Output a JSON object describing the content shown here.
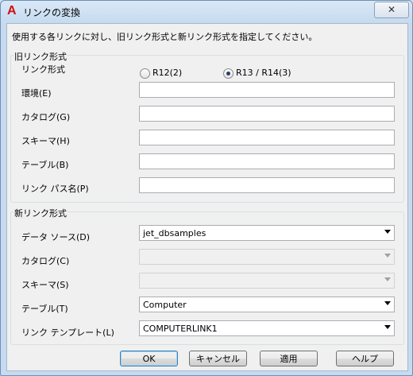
{
  "window": {
    "title": "リンクの変換",
    "close_label": "✕"
  },
  "instruction": "使用する各リンクに対し、旧リンク形式と新リンク形式を指定してください。",
  "old_link": {
    "group_title": "旧リンク形式",
    "format_label": "リンク形式",
    "radio_r12": "R12(2)",
    "radio_r13": "R13 / R14(3)",
    "selected": "R13 / R14(3)",
    "environment_label": "環境(E)",
    "environment_value": "",
    "catalog_label": "カタログ(G)",
    "catalog_value": "",
    "schema_label": "スキーマ(H)",
    "schema_value": "",
    "table_label": "テーブル(B)",
    "table_value": "",
    "path_label": "リンク パス名(P)",
    "path_value": ""
  },
  "new_link": {
    "group_title": "新リンク形式",
    "datasource_label": "データ ソース(D)",
    "datasource_value": "jet_dbsamples",
    "catalog_label": "カタログ(C)",
    "catalog_value": "",
    "schema_label": "スキーマ(S)",
    "schema_value": "",
    "table_label": "テーブル(T)",
    "table_value": "Computer",
    "template_label": "リンク テンプレート(L)",
    "template_value": "COMPUTERLINK1"
  },
  "buttons": {
    "ok": "OK",
    "cancel": "キャンセル",
    "apply": "適用",
    "help": "ヘルプ"
  }
}
